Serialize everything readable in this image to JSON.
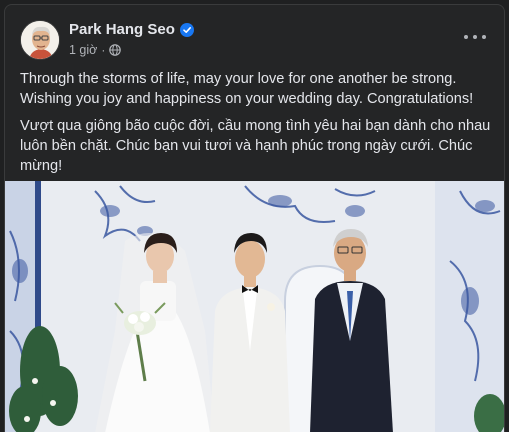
{
  "post": {
    "author": "Park Hang Seo",
    "time": "1 giờ",
    "separator": "·",
    "privacy_icon": "globe-icon",
    "verified_icon": "verified-badge-icon",
    "more_icon": "more-options-icon",
    "text_en": "Through the storms of life, may your love for one another be strong. Wishing you joy and happiness on your wedding day. Congratulations!",
    "text_vi": "Vượt qua giông bão cuộc đời, cầu mong tình yêu hai bạn dành cho nhau luôn bền chặt. Chúc bạn vui tươi và hạnh phúc trong ngày cưới. Chúc mừng!"
  },
  "colors": {
    "background": "#242526",
    "text": "#e4e6eb",
    "secondary_text": "#b0b3b8",
    "verified_blue": "#1877f2"
  }
}
